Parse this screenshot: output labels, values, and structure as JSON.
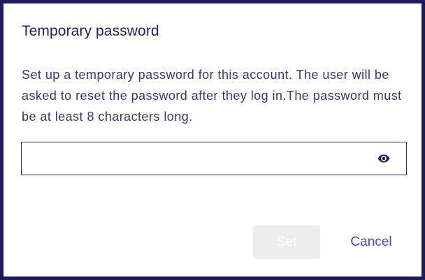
{
  "dialog": {
    "title": "Temporary password",
    "description": "Set up a temporary password for this account. The user will be asked to reset the password after they log in.The password must be at least 8 characters long.",
    "password_input": {
      "value": "",
      "placeholder": "",
      "toggle_icon": "eye-icon"
    },
    "buttons": {
      "set_label": "Set",
      "cancel_label": "Cancel"
    }
  },
  "colors": {
    "frame": "#1f1a5c",
    "title": "#231c5e",
    "text": "#3a3575",
    "accent": "#4f3fd8",
    "disabled_bg": "#ededed"
  }
}
